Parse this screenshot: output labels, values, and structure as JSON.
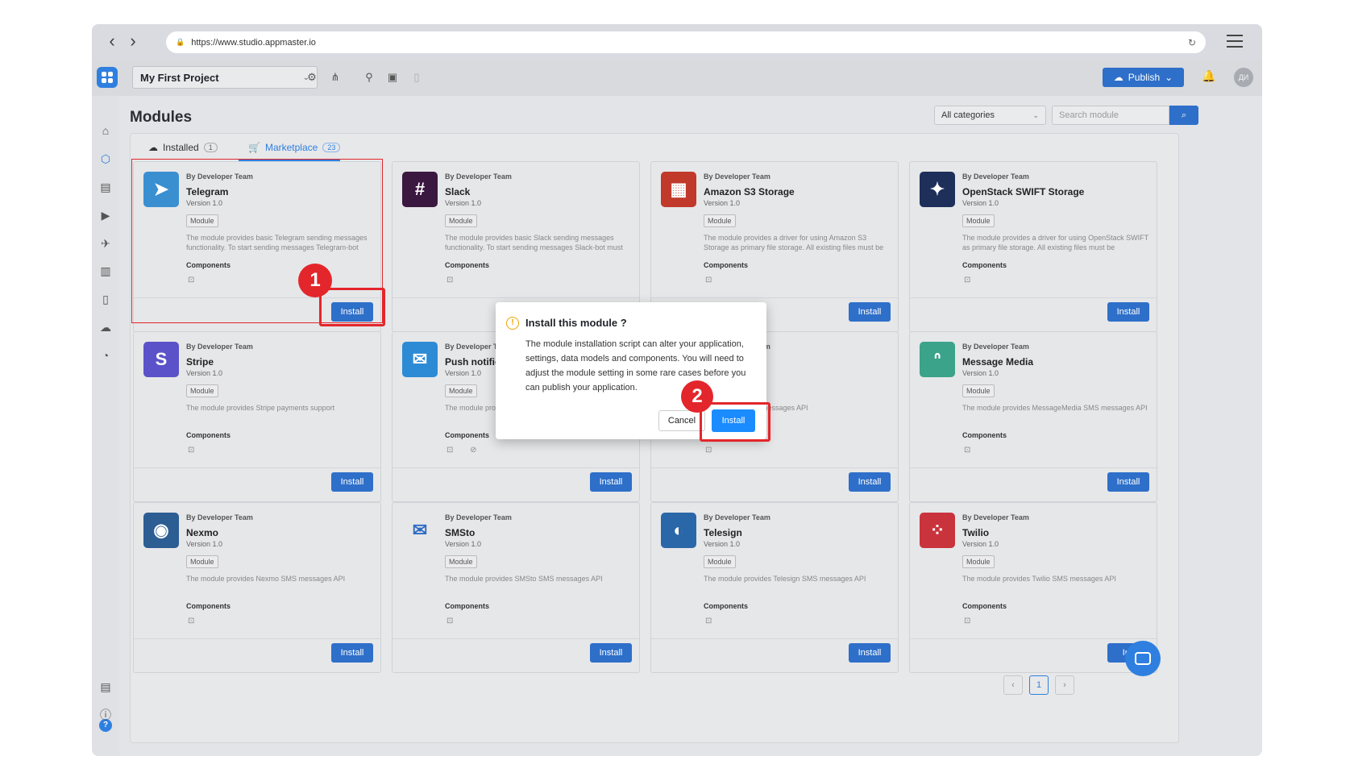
{
  "browser": {
    "url": "https://www.studio.appmaster.io",
    "back_icon": "chevron-left-icon",
    "forward_icon": "chevron-right-icon"
  },
  "header": {
    "project_name": "My First Project",
    "publish_label": "Publish",
    "avatar_initials": "ДИ"
  },
  "page": {
    "title": "Modules"
  },
  "filters": {
    "category": "All categories",
    "search_placeholder": "Search module"
  },
  "tabs": [
    {
      "label": "Installed",
      "count": "1"
    },
    {
      "label": "Marketplace",
      "count": "23"
    }
  ],
  "common": {
    "by": "By Developer Team",
    "version": "Version 1.0",
    "tag": "Module",
    "components_label": "Components",
    "install_label": "Install"
  },
  "modules": [
    {
      "name": "Telegram",
      "desc": "The module provides basic Telegram sending messages functionality. To start sending messages Telegram-bot",
      "color": "#3a8fd1",
      "icon": "paper-plane-icon"
    },
    {
      "name": "Slack",
      "desc": "The module provides basic Slack sending messages functionality. To start sending messages Slack-bot must",
      "color": "#3b1840",
      "icon": "slack-icon"
    },
    {
      "name": "Amazon S3 Storage",
      "desc": "The module provides a driver for using Amazon S3 Storage as primary file storage. All existing files must be",
      "color": "#c0392b",
      "icon": "aws-s3-icon"
    },
    {
      "name": "OpenStack SWIFT Storage",
      "desc": "The module provides a driver for using OpenStack SWIFT as primary file storage. All existing files must be",
      "color": "#1e2f5a",
      "icon": "swift-bird-icon"
    },
    {
      "name": "Stripe",
      "desc": "The module provides Stripe payments support",
      "color": "#5b52c9",
      "icon": "stripe-icon"
    },
    {
      "name": "Push notific",
      "desc": "The module pro notifications fo",
      "color": "#2d8bd6",
      "icon": "push-notification-icon"
    },
    {
      "name": "",
      "desc": "s ClickSend SMS messages API",
      "color": "#e6e7e9",
      "icon": "clicksend-icon"
    },
    {
      "name": "Message Media",
      "desc": "The module provides MessageMedia SMS messages API",
      "color": "#3aa38a",
      "icon": "messagemedia-icon"
    },
    {
      "name": "Nexmo",
      "desc": "The module provides Nexmo SMS messages API",
      "color": "#2c5d93",
      "icon": "nexmo-icon"
    },
    {
      "name": "SMSto",
      "desc": "The module provides SMSto SMS messages API",
      "color": "#e6e7e9",
      "icon": "smsto-icon"
    },
    {
      "name": "Telesign",
      "desc": "The module provides Telesign SMS messages API",
      "color": "#2a67a8",
      "icon": "telesign-icon"
    },
    {
      "name": "Twilio",
      "desc": "The module provides Twilio SMS messages API",
      "color": "#c9333c",
      "icon": "twilio-icon"
    }
  ],
  "last_install_label": "Ins",
  "dialog": {
    "title": "Install this module ?",
    "body": "The module installation script can alter your application, settings, data models and components. You will need to adjust the module setting in some rare cases before you can publish your application.",
    "cancel_label": "Cancel",
    "install_label": "Install"
  },
  "annotations": {
    "step1": "1",
    "step2": "2"
  },
  "pagination": {
    "current": "1"
  }
}
